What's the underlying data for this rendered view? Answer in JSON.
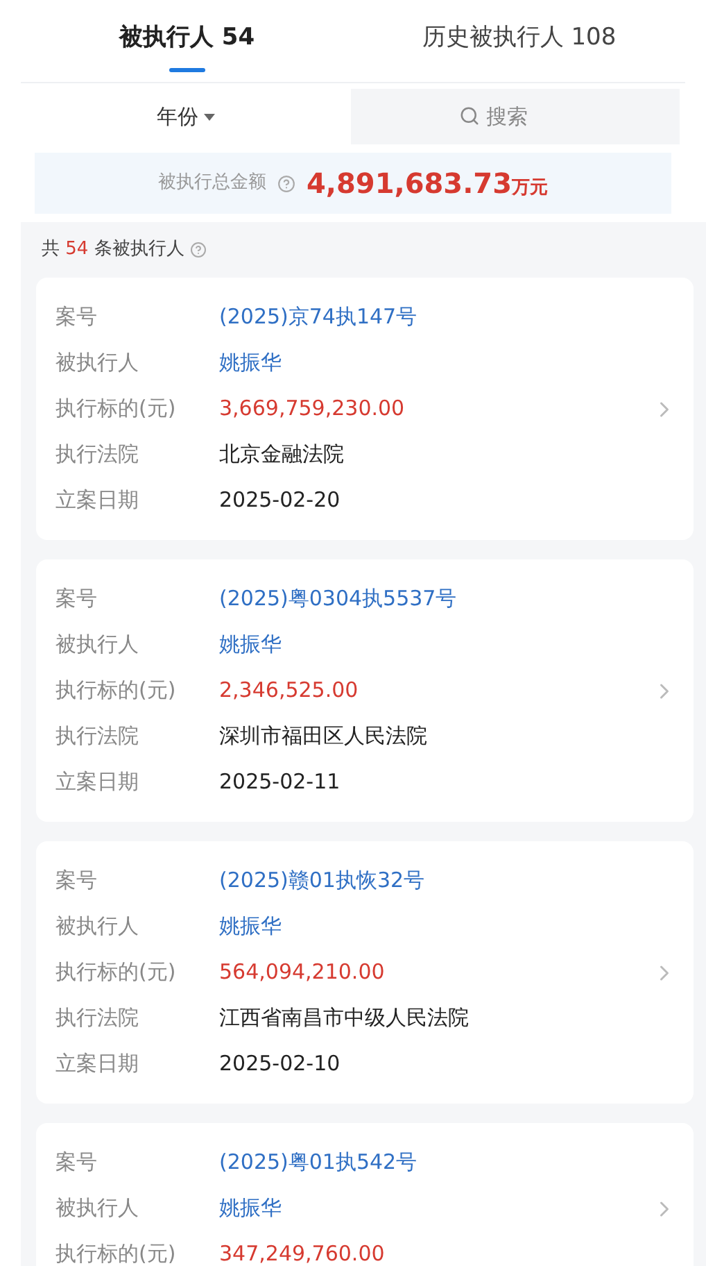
{
  "tabs": [
    {
      "label": "被执行人 54",
      "selected": true
    },
    {
      "label": "历史被执行人 108",
      "selected": false
    }
  ],
  "filter": {
    "year_label": "年份",
    "search_placeholder": "搜索"
  },
  "summary": {
    "label": "被执行总金额",
    "amount": "4,891,683.73",
    "unit": "万元"
  },
  "count": {
    "prefix": "共",
    "number": "54",
    "suffix": "条被执行人"
  },
  "cards": [
    {
      "fields": [
        {
          "label": "案号",
          "value": "(2025)京74执147号",
          "kind": "link"
        },
        {
          "label": "被执行人",
          "value": "姚振华",
          "kind": "link"
        },
        {
          "label": "执行标的(元)",
          "value": "3,669,759,230.00",
          "kind": "amount"
        },
        {
          "label": "执行法院",
          "value": "北京金融法院",
          "kind": "text"
        },
        {
          "label": "立案日期",
          "value": "2025-02-20",
          "kind": "text"
        }
      ]
    },
    {
      "fields": [
        {
          "label": "案号",
          "value": "(2025)粤0304执5537号",
          "kind": "link"
        },
        {
          "label": "被执行人",
          "value": "姚振华",
          "kind": "link"
        },
        {
          "label": "执行标的(元)",
          "value": "2,346,525.00",
          "kind": "amount"
        },
        {
          "label": "执行法院",
          "value": "深圳市福田区人民法院",
          "kind": "text"
        },
        {
          "label": "立案日期",
          "value": "2025-02-11",
          "kind": "text"
        }
      ]
    },
    {
      "fields": [
        {
          "label": "案号",
          "value": "(2025)赣01执恢32号",
          "kind": "link"
        },
        {
          "label": "被执行人",
          "value": "姚振华",
          "kind": "link"
        },
        {
          "label": "执行标的(元)",
          "value": "564,094,210.00",
          "kind": "amount"
        },
        {
          "label": "执行法院",
          "value": "江西省南昌市中级人民法院",
          "kind": "text"
        },
        {
          "label": "立案日期",
          "value": "2025-02-10",
          "kind": "text"
        }
      ]
    },
    {
      "fields": [
        {
          "label": "案号",
          "value": "(2025)粤01执542号",
          "kind": "link"
        },
        {
          "label": "被执行人",
          "value": "姚振华",
          "kind": "link"
        },
        {
          "label": "执行标的(元)",
          "value": "347,249,760.00",
          "kind": "amount"
        }
      ]
    }
  ]
}
